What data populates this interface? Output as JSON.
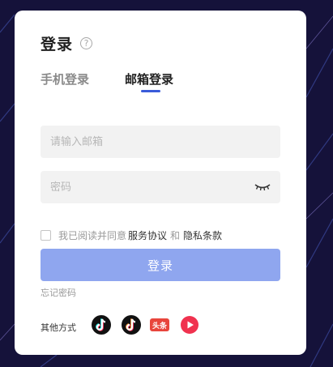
{
  "login": {
    "title": "登录",
    "help_icon": "?",
    "tabs": [
      {
        "label": "手机登录",
        "active": false
      },
      {
        "label": "邮箱登录",
        "active": true
      }
    ],
    "email_placeholder": "请输入邮箱",
    "password_placeholder": "密码",
    "agree_prefix": "我已阅读并同意",
    "terms_link": "服务协议",
    "agree_and": "和",
    "privacy_link": "隐私条款",
    "submit_label": "登录",
    "forgot_label": "忘记密码",
    "other_methods_label": "其他方式",
    "social_icons": [
      "douyin-icon",
      "douyin-icon",
      "toutiao-icon",
      "xigua-icon"
    ],
    "toutiao_icon_text": "头条"
  },
  "colors": {
    "background": "#15123a",
    "accent": "#3a5bd9",
    "button_disabled": "#8fa6ef",
    "toutiao_red": "#e8453c",
    "xigua_red": "#f0324f"
  }
}
